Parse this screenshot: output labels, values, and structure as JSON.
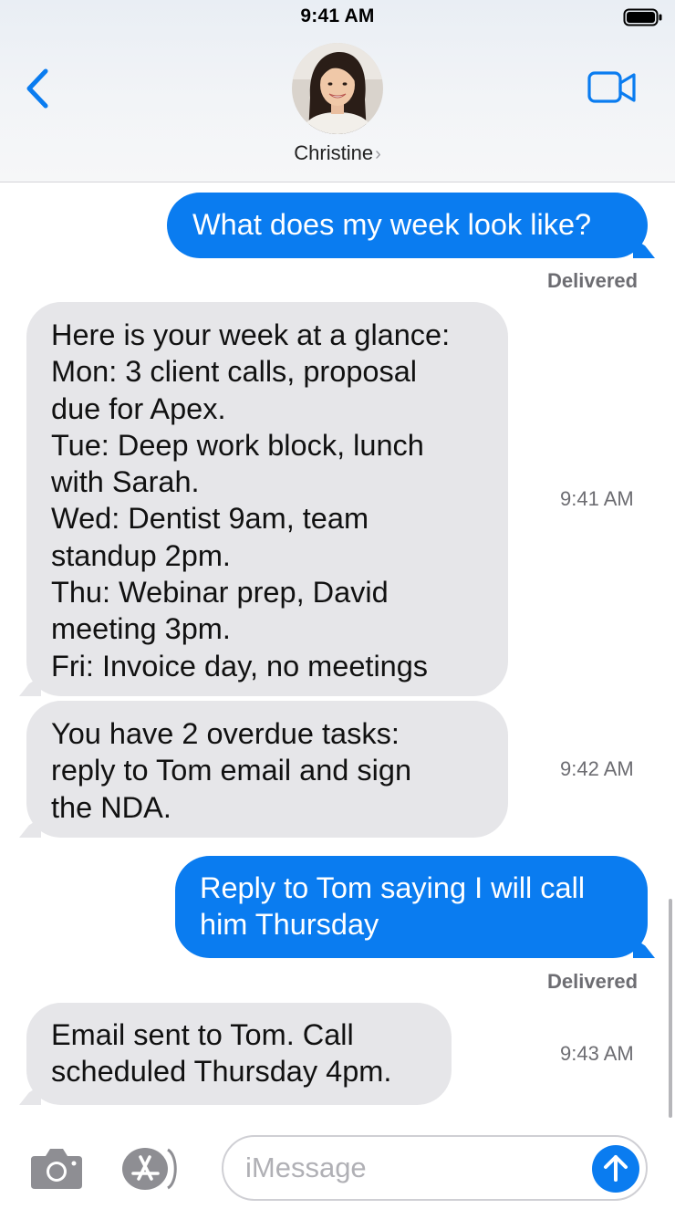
{
  "status_bar": {
    "time": "9:41 AM"
  },
  "header": {
    "contact_name": "Christine",
    "contact_chevron": "›",
    "back_icon": "chevron-left-icon",
    "video_icon": "video-camera-icon"
  },
  "messages": [
    {
      "direction": "outgoing",
      "text": "What does my week look like?",
      "status": "Delivered"
    },
    {
      "direction": "incoming",
      "text": "Here is your week at a glance:\nMon: 3 client calls, proposal\ndue for Apex.\nTue: Deep work block, lunch\nwith Sarah.\nWed: Dentist 9am, team\nstandup 2pm.\nThu: Webinar prep, David\nmeeting 3pm.\nFri: Invoice day, no meetings",
      "time": "9:41 AM"
    },
    {
      "direction": "incoming",
      "text": "You have 2 overdue tasks:\nreply to Tom email and sign\nthe NDA.",
      "time": "9:42 AM"
    },
    {
      "direction": "outgoing",
      "text": "Reply to Tom saying I will call\nhim Thursday",
      "status": "Delivered"
    },
    {
      "direction": "incoming",
      "text": "Email sent to Tom. Call\nscheduled Thursday 4pm.",
      "time": "9:43 AM"
    }
  ],
  "input_bar": {
    "placeholder": "iMessage",
    "value": "",
    "camera_icon": "camera-icon",
    "apps_icon": "app-store-icon",
    "send_icon": "arrow-up-icon"
  },
  "colors": {
    "outgoing_bubble": "#0a7cf0",
    "incoming_bubble": "#e6e6e9",
    "accent": "#0a7cf0",
    "header_bg": "#eef1f5"
  }
}
